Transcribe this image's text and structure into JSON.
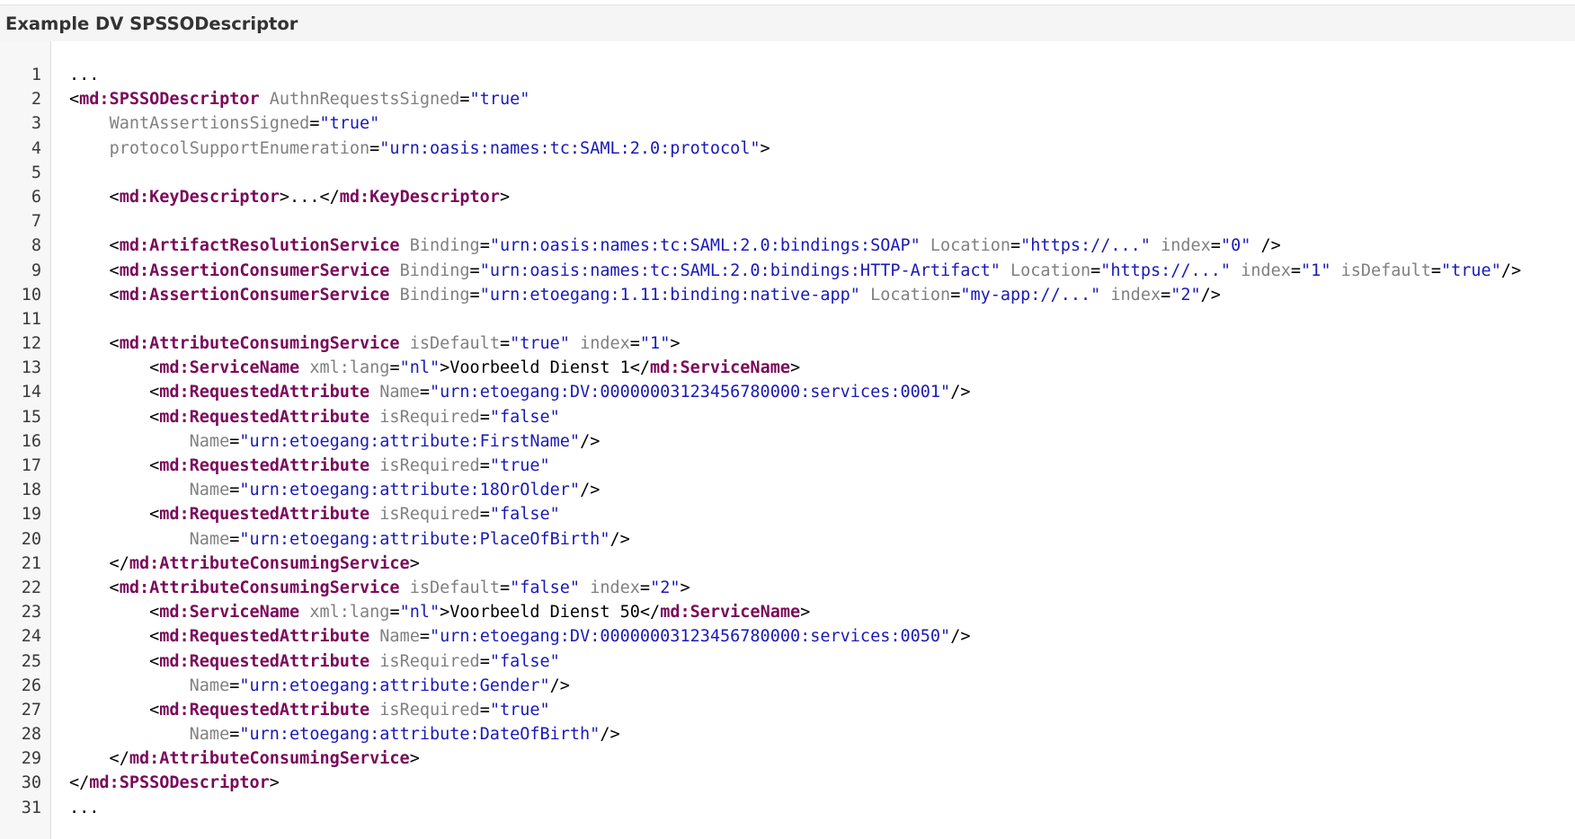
{
  "panel": {
    "title": "Example DV SPSSODescriptor"
  },
  "colors": {
    "tag": "#7a0a5a",
    "attribute": "#808080",
    "value": "#1a1ab8",
    "text": "#000000",
    "header_bg": "#f5f5f5",
    "gutter_bg": "#f7f7f7"
  },
  "code": {
    "lines": [
      [
        [
          "pun",
          "..."
        ]
      ],
      [
        [
          "pun",
          "<"
        ],
        [
          "tag",
          "md:SPSSODescriptor"
        ],
        [
          "pun",
          " "
        ],
        [
          "attr",
          "AuthnRequestsSigned"
        ],
        [
          "pun",
          "="
        ],
        [
          "val",
          "\"true\""
        ]
      ],
      [
        [
          "pun",
          "    "
        ],
        [
          "attr",
          "WantAssertionsSigned"
        ],
        [
          "pun",
          "="
        ],
        [
          "val",
          "\"true\""
        ]
      ],
      [
        [
          "pun",
          "    "
        ],
        [
          "attr",
          "protocolSupportEnumeration"
        ],
        [
          "pun",
          "="
        ],
        [
          "val",
          "\"urn:oasis:names:tc:SAML:2.0:protocol\""
        ],
        [
          "pun",
          ">"
        ]
      ],
      [],
      [
        [
          "pun",
          "    <"
        ],
        [
          "tag",
          "md:KeyDescriptor"
        ],
        [
          "pun",
          ">...</"
        ],
        [
          "tag",
          "md:KeyDescriptor"
        ],
        [
          "pun",
          ">"
        ]
      ],
      [],
      [
        [
          "pun",
          "    <"
        ],
        [
          "tag",
          "md:ArtifactResolutionService"
        ],
        [
          "pun",
          " "
        ],
        [
          "attr",
          "Binding"
        ],
        [
          "pun",
          "="
        ],
        [
          "val",
          "\"urn:oasis:names:tc:SAML:2.0:bindings:SOAP\""
        ],
        [
          "pun",
          " "
        ],
        [
          "attr",
          "Location"
        ],
        [
          "pun",
          "="
        ],
        [
          "val",
          "\"https://...\""
        ],
        [
          "pun",
          " "
        ],
        [
          "attr",
          "index"
        ],
        [
          "pun",
          "="
        ],
        [
          "val",
          "\"0\""
        ],
        [
          "pun",
          " />"
        ]
      ],
      [
        [
          "pun",
          "    <"
        ],
        [
          "tag",
          "md:AssertionConsumerService"
        ],
        [
          "pun",
          " "
        ],
        [
          "attr",
          "Binding"
        ],
        [
          "pun",
          "="
        ],
        [
          "val",
          "\"urn:oasis:names:tc:SAML:2.0:bindings:HTTP-Artifact\""
        ],
        [
          "pun",
          " "
        ],
        [
          "attr",
          "Location"
        ],
        [
          "pun",
          "="
        ],
        [
          "val",
          "\"https://...\""
        ],
        [
          "pun",
          " "
        ],
        [
          "attr",
          "index"
        ],
        [
          "pun",
          "="
        ],
        [
          "val",
          "\"1\""
        ],
        [
          "pun",
          " "
        ],
        [
          "attr",
          "isDefault"
        ],
        [
          "pun",
          "="
        ],
        [
          "val",
          "\"true\""
        ],
        [
          "pun",
          "/>"
        ]
      ],
      [
        [
          "pun",
          "    <"
        ],
        [
          "tag",
          "md:AssertionConsumerService"
        ],
        [
          "pun",
          " "
        ],
        [
          "attr",
          "Binding"
        ],
        [
          "pun",
          "="
        ],
        [
          "val",
          "\"urn:etoegang:1.11:binding:native-app\""
        ],
        [
          "pun",
          " "
        ],
        [
          "attr",
          "Location"
        ],
        [
          "pun",
          "="
        ],
        [
          "val",
          "\"my-app://...\""
        ],
        [
          "pun",
          " "
        ],
        [
          "attr",
          "index"
        ],
        [
          "pun",
          "="
        ],
        [
          "val",
          "\"2\""
        ],
        [
          "pun",
          "/>"
        ]
      ],
      [],
      [
        [
          "pun",
          "    <"
        ],
        [
          "tag",
          "md:AttributeConsumingService"
        ],
        [
          "pun",
          " "
        ],
        [
          "attr",
          "isDefault"
        ],
        [
          "pun",
          "="
        ],
        [
          "val",
          "\"true\""
        ],
        [
          "pun",
          " "
        ],
        [
          "attr",
          "index"
        ],
        [
          "pun",
          "="
        ],
        [
          "val",
          "\"1\""
        ],
        [
          "pun",
          ">"
        ]
      ],
      [
        [
          "pun",
          "        <"
        ],
        [
          "tag",
          "md:ServiceName"
        ],
        [
          "pun",
          " "
        ],
        [
          "attr",
          "xml:lang"
        ],
        [
          "pun",
          "="
        ],
        [
          "val",
          "\"nl\""
        ],
        [
          "pun",
          ">"
        ],
        [
          "txt",
          "Voorbeeld Dienst 1"
        ],
        [
          "pun",
          "</"
        ],
        [
          "tag",
          "md:ServiceName"
        ],
        [
          "pun",
          ">"
        ]
      ],
      [
        [
          "pun",
          "        <"
        ],
        [
          "tag",
          "md:RequestedAttribute"
        ],
        [
          "pun",
          " "
        ],
        [
          "attr",
          "Name"
        ],
        [
          "pun",
          "="
        ],
        [
          "val",
          "\"urn:etoegang:DV:00000003123456780000:services:0001\""
        ],
        [
          "pun",
          "/>"
        ]
      ],
      [
        [
          "pun",
          "        <"
        ],
        [
          "tag",
          "md:RequestedAttribute"
        ],
        [
          "pun",
          " "
        ],
        [
          "attr",
          "isRequired"
        ],
        [
          "pun",
          "="
        ],
        [
          "val",
          "\"false\""
        ]
      ],
      [
        [
          "pun",
          "            "
        ],
        [
          "attr",
          "Name"
        ],
        [
          "pun",
          "="
        ],
        [
          "val",
          "\"urn:etoegang:attribute:FirstName\""
        ],
        [
          "pun",
          "/>"
        ]
      ],
      [
        [
          "pun",
          "        <"
        ],
        [
          "tag",
          "md:RequestedAttribute"
        ],
        [
          "pun",
          " "
        ],
        [
          "attr",
          "isRequired"
        ],
        [
          "pun",
          "="
        ],
        [
          "val",
          "\"true\""
        ]
      ],
      [
        [
          "pun",
          "            "
        ],
        [
          "attr",
          "Name"
        ],
        [
          "pun",
          "="
        ],
        [
          "val",
          "\"urn:etoegang:attribute:18OrOlder\""
        ],
        [
          "pun",
          "/>"
        ]
      ],
      [
        [
          "pun",
          "        <"
        ],
        [
          "tag",
          "md:RequestedAttribute"
        ],
        [
          "pun",
          " "
        ],
        [
          "attr",
          "isRequired"
        ],
        [
          "pun",
          "="
        ],
        [
          "val",
          "\"false\""
        ]
      ],
      [
        [
          "pun",
          "            "
        ],
        [
          "attr",
          "Name"
        ],
        [
          "pun",
          "="
        ],
        [
          "val",
          "\"urn:etoegang:attribute:PlaceOfBirth\""
        ],
        [
          "pun",
          "/>"
        ]
      ],
      [
        [
          "pun",
          "    </"
        ],
        [
          "tag",
          "md:AttributeConsumingService"
        ],
        [
          "pun",
          ">"
        ]
      ],
      [
        [
          "pun",
          "    <"
        ],
        [
          "tag",
          "md:AttributeConsumingService"
        ],
        [
          "pun",
          " "
        ],
        [
          "attr",
          "isDefault"
        ],
        [
          "pun",
          "="
        ],
        [
          "val",
          "\"false\""
        ],
        [
          "pun",
          " "
        ],
        [
          "attr",
          "index"
        ],
        [
          "pun",
          "="
        ],
        [
          "val",
          "\"2\""
        ],
        [
          "pun",
          ">"
        ]
      ],
      [
        [
          "pun",
          "        <"
        ],
        [
          "tag",
          "md:ServiceName"
        ],
        [
          "pun",
          " "
        ],
        [
          "attr",
          "xml:lang"
        ],
        [
          "pun",
          "="
        ],
        [
          "val",
          "\"nl\""
        ],
        [
          "pun",
          ">"
        ],
        [
          "txt",
          "Voorbeeld Dienst 50"
        ],
        [
          "pun",
          "</"
        ],
        [
          "tag",
          "md:ServiceName"
        ],
        [
          "pun",
          ">"
        ]
      ],
      [
        [
          "pun",
          "        <"
        ],
        [
          "tag",
          "md:RequestedAttribute"
        ],
        [
          "pun",
          " "
        ],
        [
          "attr",
          "Name"
        ],
        [
          "pun",
          "="
        ],
        [
          "val",
          "\"urn:etoegang:DV:00000003123456780000:services:0050\""
        ],
        [
          "pun",
          "/>"
        ]
      ],
      [
        [
          "pun",
          "        <"
        ],
        [
          "tag",
          "md:RequestedAttribute"
        ],
        [
          "pun",
          " "
        ],
        [
          "attr",
          "isRequired"
        ],
        [
          "pun",
          "="
        ],
        [
          "val",
          "\"false\""
        ]
      ],
      [
        [
          "pun",
          "            "
        ],
        [
          "attr",
          "Name"
        ],
        [
          "pun",
          "="
        ],
        [
          "val",
          "\"urn:etoegang:attribute:Gender\""
        ],
        [
          "pun",
          "/>"
        ]
      ],
      [
        [
          "pun",
          "        <"
        ],
        [
          "tag",
          "md:RequestedAttribute"
        ],
        [
          "pun",
          " "
        ],
        [
          "attr",
          "isRequired"
        ],
        [
          "pun",
          "="
        ],
        [
          "val",
          "\"true\""
        ]
      ],
      [
        [
          "pun",
          "            "
        ],
        [
          "attr",
          "Name"
        ],
        [
          "pun",
          "="
        ],
        [
          "val",
          "\"urn:etoegang:attribute:DateOfBirth\""
        ],
        [
          "pun",
          "/>"
        ]
      ],
      [
        [
          "pun",
          "    </"
        ],
        [
          "tag",
          "md:AttributeConsumingService"
        ],
        [
          "pun",
          ">"
        ]
      ],
      [
        [
          "pun",
          "</"
        ],
        [
          "tag",
          "md:SPSSODescriptor"
        ],
        [
          "pun",
          ">"
        ]
      ],
      [
        [
          "pun",
          "..."
        ]
      ]
    ]
  }
}
